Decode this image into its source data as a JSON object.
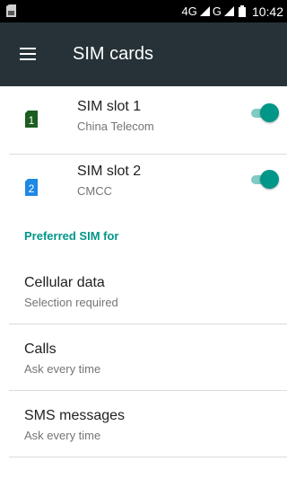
{
  "status_bar": {
    "network_label": "4G",
    "network_label_2": "G",
    "time": "10:42",
    "icons": [
      "sim-status-icon",
      "signal-icon",
      "battery-icon"
    ]
  },
  "app_bar": {
    "title": "SIM cards",
    "menu_icon": "hamburger-menu-icon"
  },
  "sims": [
    {
      "icon_number": "1",
      "title": "SIM slot 1",
      "carrier": "China Telecom",
      "enabled": true,
      "icon_color": "#1b5e20"
    },
    {
      "icon_number": "2",
      "title": "SIM slot 2",
      "carrier": "CMCC",
      "enabled": true,
      "icon_color": "#1e88e5"
    }
  ],
  "preferred": {
    "header": "Preferred SIM for",
    "items": [
      {
        "title": "Cellular data",
        "subtitle": "Selection required"
      },
      {
        "title": "Calls",
        "subtitle": "Ask every time"
      },
      {
        "title": "SMS messages",
        "subtitle": "Ask every time"
      }
    ]
  },
  "colors": {
    "app_bar": "#263238",
    "accent": "#009688",
    "toggle_track": "#80cbc4"
  }
}
